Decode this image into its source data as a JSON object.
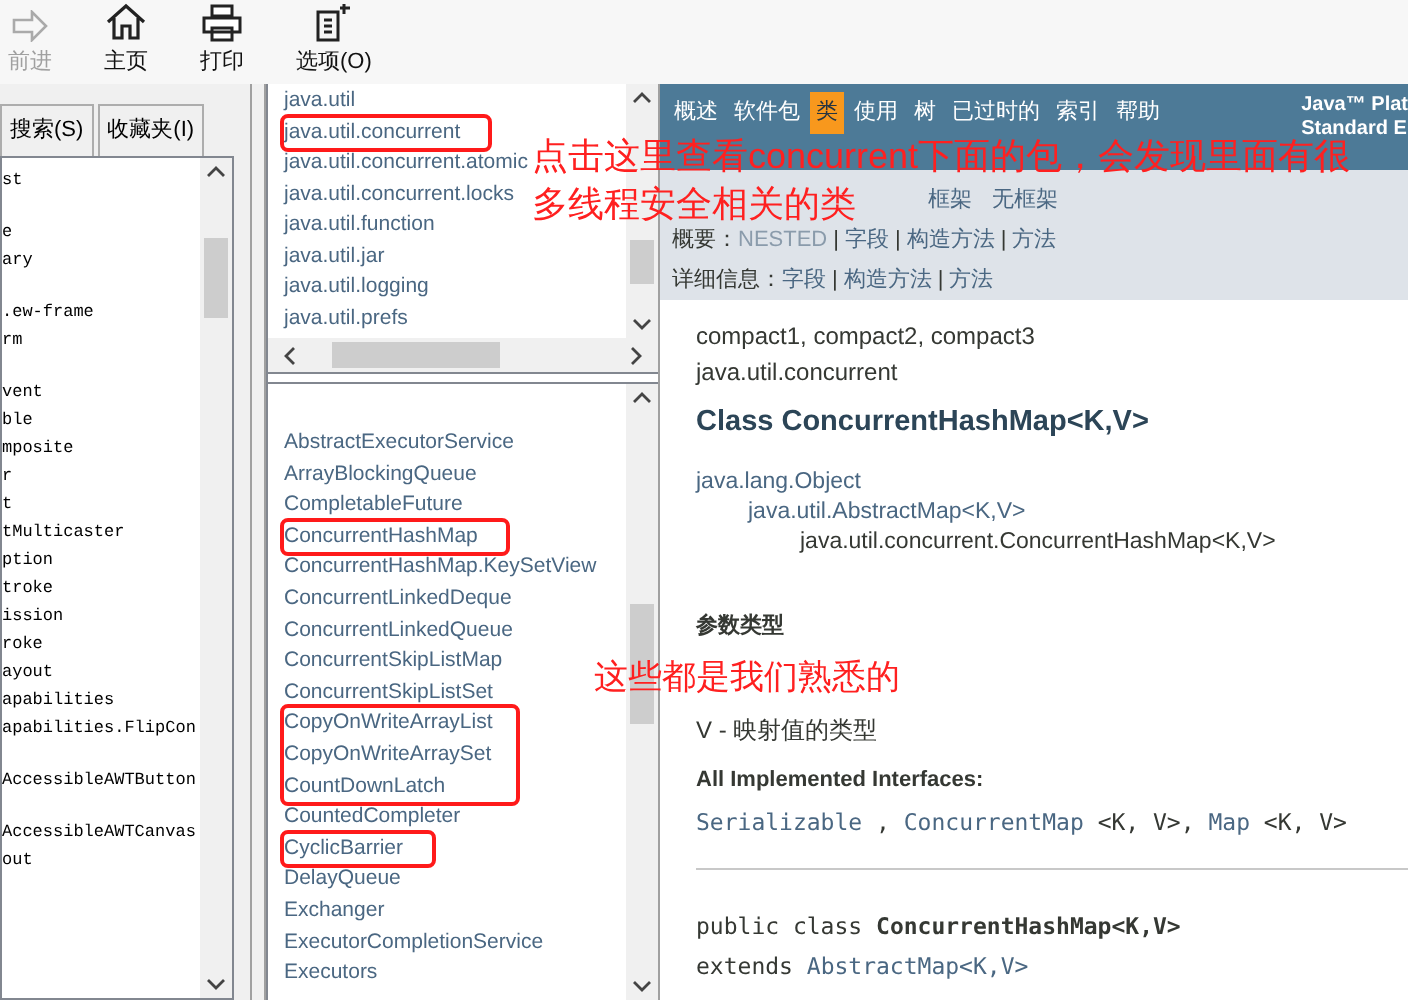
{
  "toolbar": [
    {
      "kind": "forward",
      "label": "前进",
      "disabled": true
    },
    {
      "kind": "home",
      "label": "主页",
      "disabled": false
    },
    {
      "kind": "print",
      "label": "打印",
      "disabled": false
    },
    {
      "kind": "options",
      "label": "选项(O)",
      "disabled": false
    }
  ],
  "left_tabs": [
    {
      "label": "搜索(S)",
      "selected": false
    },
    {
      "label": "收藏夹(I)",
      "selected": false
    }
  ],
  "index_groups": [
    [
      "st"
    ],
    [
      "e",
      "ary"
    ],
    [
      ".ew-frame",
      "rm"
    ],
    [
      "vent",
      "ble",
      "mposite",
      "r",
      "t",
      "tMulticaster",
      "ption",
      "troke",
      "ission",
      "roke",
      "ayout",
      "apabilities",
      "apabilities.FlipCon"
    ],
    [
      "AccessibleAWTButton"
    ],
    [
      "AccessibleAWTCanvas",
      "out"
    ]
  ],
  "packages": [
    {
      "label": "java.util",
      "boxed": false
    },
    {
      "label": "java.util.concurrent",
      "boxed": true
    },
    {
      "label": "java.util.concurrent.atomic",
      "boxed": false
    },
    {
      "label": "java.util.concurrent.locks",
      "boxed": false
    },
    {
      "label": "java.util.function",
      "boxed": false
    },
    {
      "label": "java.util.jar",
      "boxed": false
    },
    {
      "label": "java.util.logging",
      "boxed": false
    },
    {
      "label": "java.util.prefs",
      "boxed": false
    }
  ],
  "classes": [
    {
      "kind": "item",
      "label": "AbstractExecutorService",
      "boxed": false
    },
    {
      "kind": "item",
      "label": "ArrayBlockingQueue",
      "boxed": false
    },
    {
      "kind": "item",
      "label": "CompletableFuture",
      "boxed": false
    },
    {
      "kind": "item",
      "label": "ConcurrentHashMap",
      "boxed": true
    },
    {
      "kind": "item",
      "label": "ConcurrentHashMap.KeySetView",
      "boxed": false
    },
    {
      "kind": "item",
      "label": "ConcurrentLinkedDeque",
      "boxed": false
    },
    {
      "kind": "item",
      "label": "ConcurrentLinkedQueue",
      "boxed": false
    },
    {
      "kind": "item",
      "label": "ConcurrentSkipListMap",
      "boxed": false
    },
    {
      "kind": "item",
      "label": "ConcurrentSkipListSet",
      "boxed": false
    },
    {
      "kind": "group",
      "items": [
        "CopyOnWriteArrayList",
        "CopyOnWriteArraySet",
        "CountDownLatch"
      ]
    },
    {
      "kind": "item",
      "label": "CountedCompleter",
      "boxed": false
    },
    {
      "kind": "item",
      "label": "CyclicBarrier",
      "boxed": true
    },
    {
      "kind": "item",
      "label": "DelayQueue",
      "boxed": false
    },
    {
      "kind": "item",
      "label": "Exchanger",
      "boxed": false
    },
    {
      "kind": "item",
      "label": "ExecutorCompletionService",
      "boxed": false
    },
    {
      "kind": "item",
      "label": "Executors",
      "boxed": false
    }
  ],
  "nav": [
    {
      "label": "概述",
      "selected": false
    },
    {
      "label": "软件包",
      "selected": false
    },
    {
      "label": "类",
      "selected": true
    },
    {
      "label": "使用",
      "selected": false
    },
    {
      "label": "树",
      "selected": false
    },
    {
      "label": "已过时的",
      "selected": false
    },
    {
      "label": "索引",
      "selected": false
    },
    {
      "label": "帮助",
      "selected": false
    }
  ],
  "header_lines": [
    "Java™ Plat",
    "Standard E"
  ],
  "subnav": {
    "frames": [
      "框架",
      "无框架"
    ],
    "summary": {
      "label": "概要：",
      "links": [
        {
          "text": "NESTED",
          "link": false
        },
        {
          "text": "字段",
          "link": true
        },
        {
          "text": "构造方法",
          "link": true
        },
        {
          "text": "方法",
          "link": true
        }
      ]
    },
    "detail": {
      "label": "详细信息：",
      "links": [
        {
          "text": "字段",
          "link": true
        },
        {
          "text": "构造方法",
          "link": true
        },
        {
          "text": "方法",
          "link": true
        }
      ]
    },
    "separator": "|"
  },
  "content": {
    "profiles": "compact1, compact2, compact3",
    "package": "java.util.concurrent",
    "title": "Class ConcurrentHashMap<K,V>",
    "hierarchy": [
      {
        "text": "java.lang.Object",
        "link": true
      },
      {
        "text": "java.util.AbstractMap<K,V>",
        "link": true
      },
      {
        "text": "java.util.concurrent.ConcurrentHashMap<K,V>",
        "link": false
      }
    ],
    "params_heading": "参数类型",
    "params": [
      "V - 映射值的类型"
    ],
    "interfaces_heading": "All Implemented Interfaces:",
    "interfaces": [
      {
        "name": "Serializable",
        "sep": " , "
      },
      {
        "name": "ConcurrentMap",
        "generic": " <K, V>",
        "sep": ", "
      },
      {
        "name": "Map",
        "generic": " <K, V>"
      }
    ],
    "decl_keyword": "public class ",
    "decl_name": "ConcurrentHashMap<K,V>",
    "extends_keyword": "extends ",
    "extends_name": "AbstractMap<K,V>"
  },
  "annotations": [
    [
      "点击这里查看concurrent下面的包，会发现里面有很",
      "多线程安全相关的类"
    ],
    [
      "这些都是我们熟悉的"
    ]
  ]
}
